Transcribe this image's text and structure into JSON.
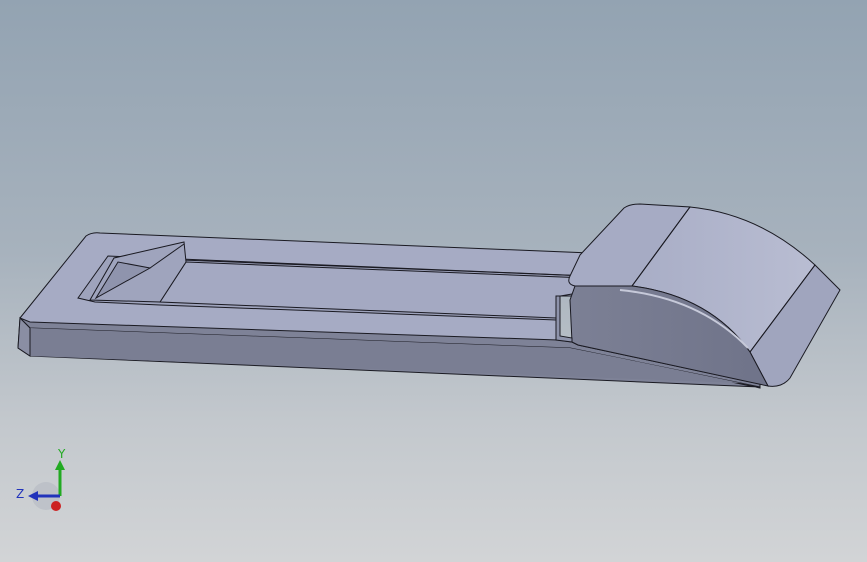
{
  "viewport": {
    "background_top": "#93a3b2",
    "background_bottom": "#d2d4d6"
  },
  "model": {
    "face_color": "#a9aec6",
    "shadow_color": "#7f8398",
    "edge_color": "#1a1a22"
  },
  "triad": {
    "y_label": "Y",
    "z_label": "Z",
    "y_color": "#22aa22",
    "z_color": "#2233bb",
    "x_color": "#cc2222"
  }
}
